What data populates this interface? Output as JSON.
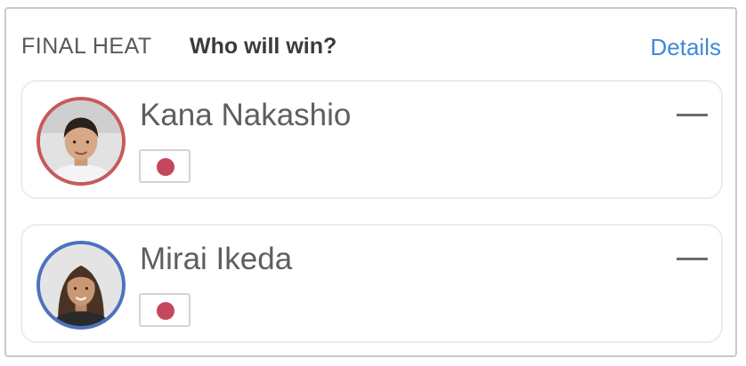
{
  "header": {
    "label": "FINAL HEAT",
    "question": "Who will win?",
    "details_link": "Details"
  },
  "competitors": [
    {
      "name": "Kana Nakashio",
      "country_flag": "japan-flag",
      "ring_color": "#c65a5a",
      "vote_indicator": "—"
    },
    {
      "name": "Mirai Ikeda",
      "country_flag": "japan-flag",
      "ring_color": "#4d72bd",
      "vote_indicator": "—"
    }
  ],
  "colors": {
    "accent_link": "#3e8ad8",
    "flag_red": "#c4485b"
  }
}
